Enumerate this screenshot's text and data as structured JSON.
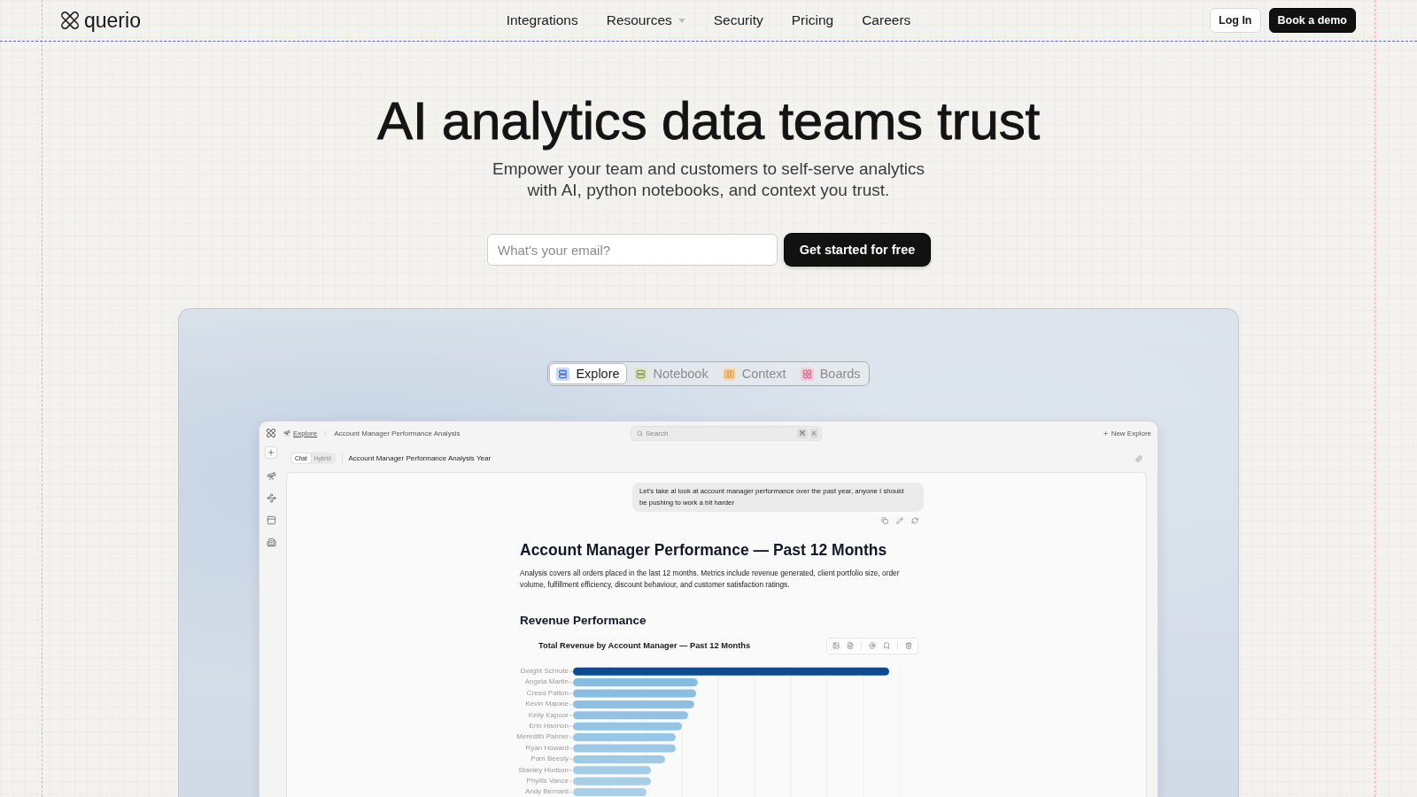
{
  "nav": {
    "brand": "querio",
    "links": [
      {
        "label": "Integrations",
        "has_menu": false
      },
      {
        "label": "Resources",
        "has_menu": true
      },
      {
        "label": "Security",
        "has_menu": false
      },
      {
        "label": "Pricing",
        "has_menu": false
      },
      {
        "label": "Careers",
        "has_menu": false
      }
    ],
    "login": "Log In",
    "cta": "Book a demo"
  },
  "hero": {
    "title": "AI analytics data teams trust",
    "subtitle": "Empower your team and customers to self-serve analytics with AI, python notebooks, and context you trust.",
    "email_placeholder": "What's your email?",
    "cta": "Get started for free"
  },
  "product_tabs": [
    {
      "label": "Explore",
      "kind": "explore",
      "selected": true
    },
    {
      "label": "Notebook",
      "kind": "notebook",
      "selected": false
    },
    {
      "label": "Context",
      "kind": "context",
      "selected": false
    },
    {
      "label": "Boards",
      "kind": "boards",
      "selected": false
    }
  ],
  "app": {
    "breadcrumb": {
      "section": "Explore",
      "page": "Account Manager Performance Analysis"
    },
    "search": {
      "placeholder": "Search",
      "keys": [
        "⌘",
        "K"
      ]
    },
    "new_button": "New Explore",
    "mode_toggle": [
      {
        "label": "Chat",
        "selected": true
      },
      {
        "label": "Hybrid",
        "selected": false
      }
    ],
    "thread_title": "Account Manager Performance Analysis Year",
    "user_message": "Let's take al look at account manager performance over the past year, anyone I should be pushing to work a bit harder",
    "report": {
      "title": "Account Manager Performance — Past 12 Months",
      "summary": "Analysis covers all orders placed in the last 12 months. Metrics include revenue generated, client portfolio size, order volume, fulfillment efficiency, discount behaviour, and customer satisfaction ratings.",
      "section_title": "Revenue Performance",
      "chart": {
        "title": "Total Revenue by Account Manager — Past 12 Months",
        "managers": [
          "Dwight Schrute",
          "Angela Martin",
          "Creed Patton",
          "Kevin Malone",
          "Kelly Kapoor",
          "Erin Hannon",
          "Meredith Palmer",
          "Ryan Howard",
          "Pam Beesly",
          "Stanley Hudson",
          "Phyllis Vance",
          "Andy Bernard"
        ]
      }
    }
  }
}
